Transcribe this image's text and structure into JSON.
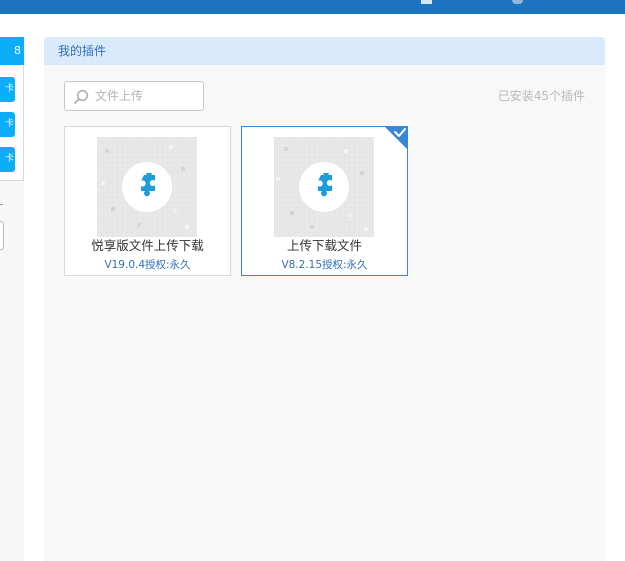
{
  "colors": {
    "topbar": "#1e73be",
    "accent": "#0baef7",
    "header_bg": "#d9ebfb",
    "header_text": "#2e6fb8",
    "selected_border": "#3a87d6",
    "puzzle": "#1e9ddb"
  },
  "panel": {
    "title": "我的插件"
  },
  "left": {
    "tab_label": "8",
    "buttons": [
      "卡",
      "卡",
      "卡"
    ]
  },
  "search": {
    "placeholder": "文件上传",
    "icon": "search-icon"
  },
  "install_count": "已安装45个插件",
  "plugins": [
    {
      "name": "悦享版文件上传下载",
      "version": "V19.0.4授权:永久",
      "icon": "puzzle-icon",
      "selected": false
    },
    {
      "name": "上传下载文件",
      "version": "V8.2.15授权:永久",
      "icon": "puzzle-icon",
      "selected": true
    }
  ]
}
